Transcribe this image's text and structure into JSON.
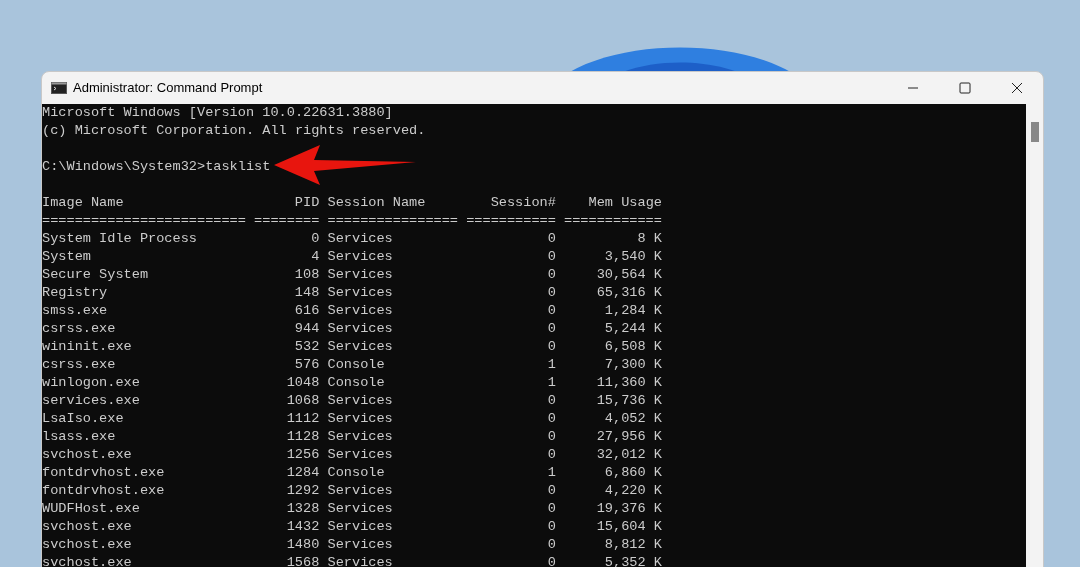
{
  "window": {
    "title": "Administrator: Command Prompt"
  },
  "console": {
    "banner": [
      "Microsoft Windows [Version 10.0.22631.3880]",
      "(c) Microsoft Corporation. All rights reserved."
    ],
    "prompt": "C:\\Windows\\System32>tasklist",
    "columns": [
      "Image Name",
      "PID",
      "Session Name",
      "Session#",
      "Mem Usage"
    ],
    "separators": [
      "=========================",
      "========",
      "================",
      "===========",
      "============"
    ],
    "rows": [
      [
        "System Idle Process",
        "0",
        "Services",
        "0",
        "8 K"
      ],
      [
        "System",
        "4",
        "Services",
        "0",
        "3,540 K"
      ],
      [
        "Secure System",
        "108",
        "Services",
        "0",
        "30,564 K"
      ],
      [
        "Registry",
        "148",
        "Services",
        "0",
        "65,316 K"
      ],
      [
        "smss.exe",
        "616",
        "Services",
        "0",
        "1,284 K"
      ],
      [
        "csrss.exe",
        "944",
        "Services",
        "0",
        "5,244 K"
      ],
      [
        "wininit.exe",
        "532",
        "Services",
        "0",
        "6,508 K"
      ],
      [
        "csrss.exe",
        "576",
        "Console",
        "1",
        "7,300 K"
      ],
      [
        "winlogon.exe",
        "1048",
        "Console",
        "1",
        "11,360 K"
      ],
      [
        "services.exe",
        "1068",
        "Services",
        "0",
        "15,736 K"
      ],
      [
        "LsaIso.exe",
        "1112",
        "Services",
        "0",
        "4,052 K"
      ],
      [
        "lsass.exe",
        "1128",
        "Services",
        "0",
        "27,956 K"
      ],
      [
        "svchost.exe",
        "1256",
        "Services",
        "0",
        "32,012 K"
      ],
      [
        "fontdrvhost.exe",
        "1284",
        "Console",
        "1",
        "6,860 K"
      ],
      [
        "fontdrvhost.exe",
        "1292",
        "Services",
        "0",
        "4,220 K"
      ],
      [
        "WUDFHost.exe",
        "1328",
        "Services",
        "0",
        "19,376 K"
      ],
      [
        "svchost.exe",
        "1432",
        "Services",
        "0",
        "15,604 K"
      ],
      [
        "svchost.exe",
        "1480",
        "Services",
        "0",
        "8,812 K"
      ],
      [
        "svchost.exe",
        "1568",
        "Services",
        "0",
        "5,352 K"
      ]
    ]
  }
}
